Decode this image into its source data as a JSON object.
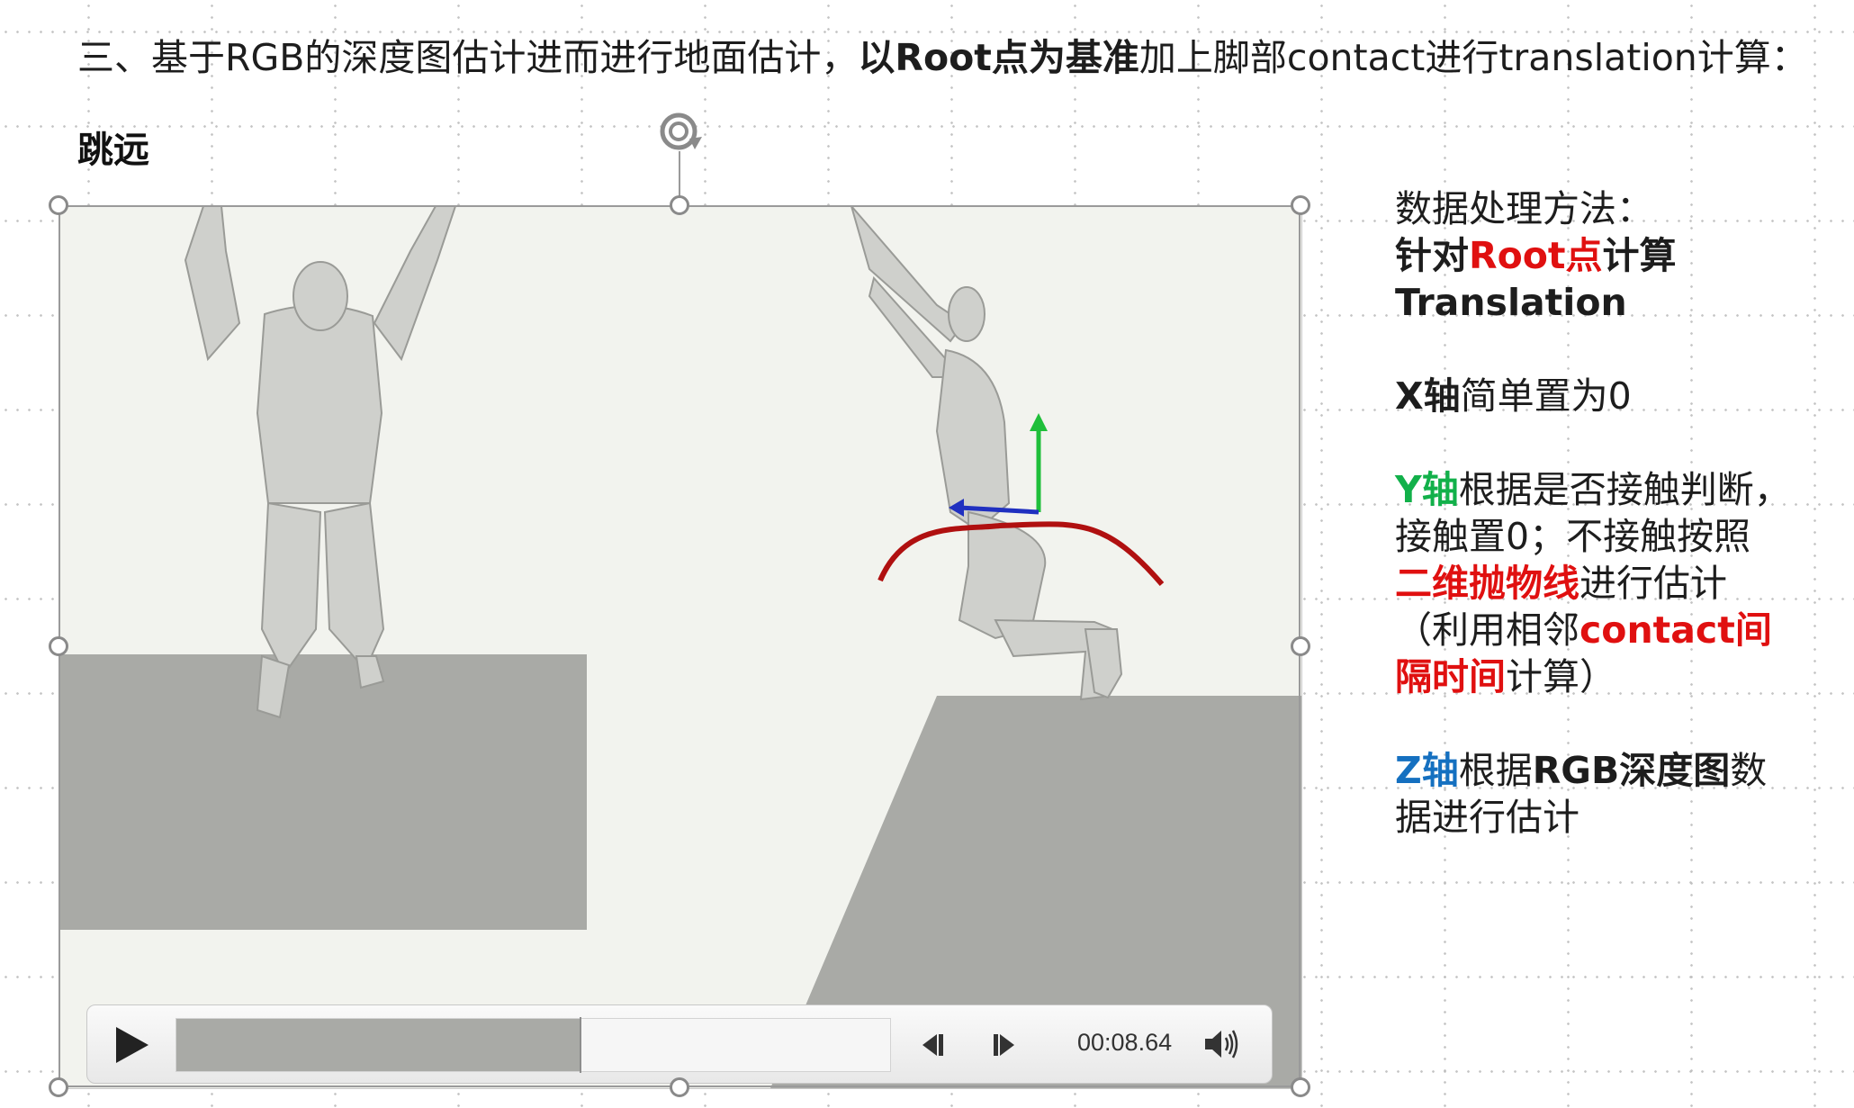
{
  "heading": {
    "part1": "三、基于RGB的深度图估计进而进行地面估计，",
    "bold": "以Root点为基准",
    "part2": "加上脚部contact进行translation计算："
  },
  "subtitle": "跳远",
  "video": {
    "time": "00:08.64",
    "progress_fraction": 0.565
  },
  "panel": {
    "method_label": "数据处理方法：",
    "line2_a": "针对",
    "line2_b": "Root点",
    "line2_c": "计算",
    "line3": "Translation",
    "x_axis": "X轴",
    "x_text": "简单置为0",
    "y_axis": "Y轴",
    "y_text1": "根据是否接触判断，",
    "y_text2": "接触置0；不接触按照",
    "y_red1": "二维抛物线",
    "y_text3": "进行估计",
    "y_text4": "（利用相邻",
    "y_red2": "contact间",
    "y_red3": "隔时间",
    "y_text5": "计算）",
    "z_axis": "Z轴",
    "z_text1": "根据",
    "z_bold": "RGB深度图",
    "z_text2": "数",
    "z_text3": "据进行估计"
  },
  "colors": {
    "red": "#e01010",
    "green": "#12b04a",
    "blue": "#1570c0",
    "ground": "#a9aaa6",
    "arc": "#b01010"
  }
}
